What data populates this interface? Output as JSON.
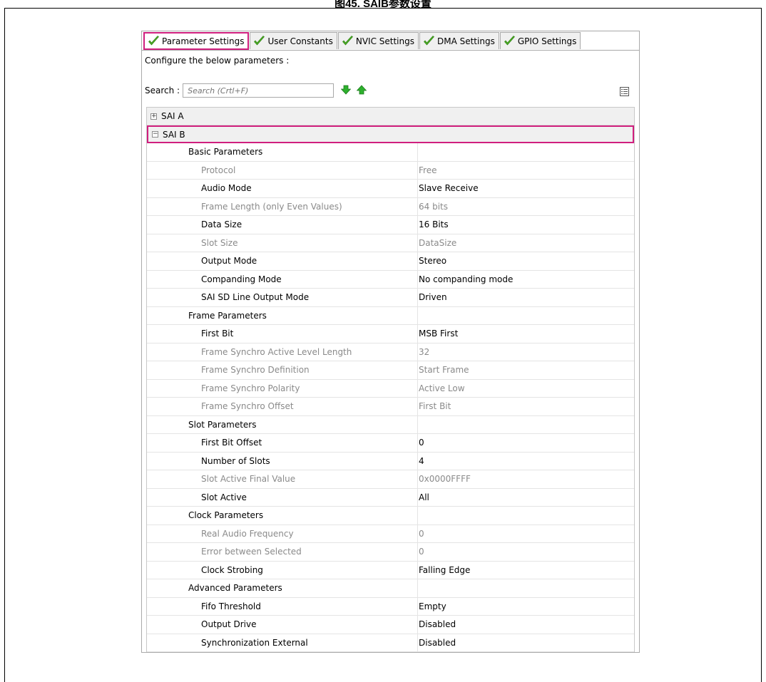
{
  "figure_caption": "图45. SAIB参数设置",
  "tabs": [
    {
      "label": "Parameter Settings",
      "active": true
    },
    {
      "label": "User Constants",
      "active": false
    },
    {
      "label": "NVIC Settings",
      "active": false
    },
    {
      "label": "DMA Settings",
      "active": false
    },
    {
      "label": "GPIO Settings",
      "active": false
    }
  ],
  "configure_label": "Configure the below parameters :",
  "search": {
    "label": "Search :",
    "placeholder": "Search (Crtl+F)"
  },
  "groups": [
    {
      "label": "SAI A",
      "expanded": false,
      "sign": "+"
    },
    {
      "label": "SAI B",
      "expanded": true,
      "sign": "−"
    }
  ],
  "rows": [
    {
      "type": "section",
      "name": "Basic Parameters",
      "value": ""
    },
    {
      "type": "param",
      "name": "Protocol",
      "value": "Free",
      "enabled": false
    },
    {
      "type": "param",
      "name": "Audio Mode",
      "value": "Slave Receive",
      "enabled": true
    },
    {
      "type": "param",
      "name": "Frame Length (only Even Values)",
      "value": "64 bits",
      "enabled": false
    },
    {
      "type": "param",
      "name": "Data Size",
      "value": "16 Bits",
      "enabled": true
    },
    {
      "type": "param",
      "name": "Slot Size",
      "value": "DataSize",
      "enabled": false
    },
    {
      "type": "param",
      "name": "Output Mode",
      "value": "Stereo",
      "enabled": true
    },
    {
      "type": "param",
      "name": "Companding Mode",
      "value": "No companding mode",
      "enabled": true
    },
    {
      "type": "param",
      "name": "SAI SD Line Output Mode",
      "value": "Driven",
      "enabled": true
    },
    {
      "type": "section",
      "name": "Frame Parameters",
      "value": ""
    },
    {
      "type": "param",
      "name": "First Bit",
      "value": "MSB First",
      "enabled": true
    },
    {
      "type": "param",
      "name": "Frame Synchro Active Level Length",
      "value": "32",
      "enabled": false
    },
    {
      "type": "param",
      "name": "Frame Synchro Definition",
      "value": "Start Frame",
      "enabled": false
    },
    {
      "type": "param",
      "name": "Frame Synchro Polarity",
      "value": "Active Low",
      "enabled": false
    },
    {
      "type": "param",
      "name": "Frame Synchro Offset",
      "value": "First Bit",
      "enabled": false
    },
    {
      "type": "section",
      "name": "Slot Parameters",
      "value": ""
    },
    {
      "type": "param",
      "name": "First Bit Offset",
      "value": "0",
      "enabled": true
    },
    {
      "type": "param",
      "name": "Number of Slots",
      "value": "4",
      "enabled": true
    },
    {
      "type": "param",
      "name": "Slot Active Final Value",
      "value": "0x0000FFFF",
      "enabled": false
    },
    {
      "type": "param",
      "name": "Slot Active",
      "value": "All",
      "enabled": true
    },
    {
      "type": "section",
      "name": "Clock Parameters",
      "value": ""
    },
    {
      "type": "param",
      "name": "Real Audio Frequency",
      "value": "0",
      "enabled": false
    },
    {
      "type": "param",
      "name": "Error between Selected",
      "value": "0",
      "enabled": false
    },
    {
      "type": "param",
      "name": "Clock Strobing",
      "value": "Falling Edge",
      "enabled": true
    },
    {
      "type": "section",
      "name": "Advanced Parameters",
      "value": ""
    },
    {
      "type": "param",
      "name": "Fifo Threshold",
      "value": "Empty",
      "enabled": true
    },
    {
      "type": "param",
      "name": "Output Drive",
      "value": "Disabled",
      "enabled": true
    },
    {
      "type": "param",
      "name": "Synchronization External",
      "value": "Disabled",
      "enabled": true
    }
  ],
  "icons": {
    "tab_check": "check-icon",
    "search_next": "arrow-down-icon",
    "search_prev": "arrow-up-icon",
    "view_toggle": "list-view-icon",
    "collapsed": "plus-box-icon",
    "expanded": "minus-box-icon"
  },
  "colors": {
    "highlight": "#d01f7e",
    "check": "#4caf24",
    "arrow": "#2db02d",
    "disabled_text": "#8a8a8a"
  }
}
